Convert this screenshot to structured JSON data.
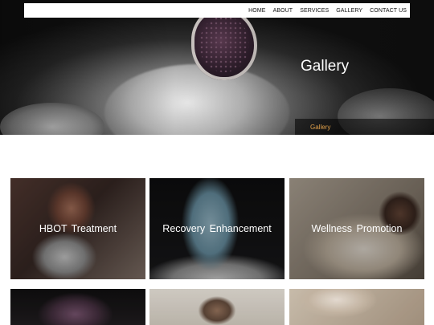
{
  "nav": {
    "items": [
      {
        "label": "HOME"
      },
      {
        "label": "ABOUT"
      },
      {
        "label": "SERVICES"
      },
      {
        "label": "GALLERY"
      },
      {
        "label": "CONTACT US"
      }
    ]
  },
  "hero": {
    "title": "Gallery",
    "breadcrumb": "Gallery"
  },
  "gallery": {
    "items": [
      {
        "label": "HBOT  Treatment"
      },
      {
        "label": "Recovery  Enhancement"
      },
      {
        "label": "Wellness  Promotion"
      },
      {
        "label": ""
      },
      {
        "label": ""
      },
      {
        "label": ""
      }
    ]
  },
  "colors": {
    "breadcrumb_text": "#e0a04a",
    "nav_background": "#ffffff"
  }
}
